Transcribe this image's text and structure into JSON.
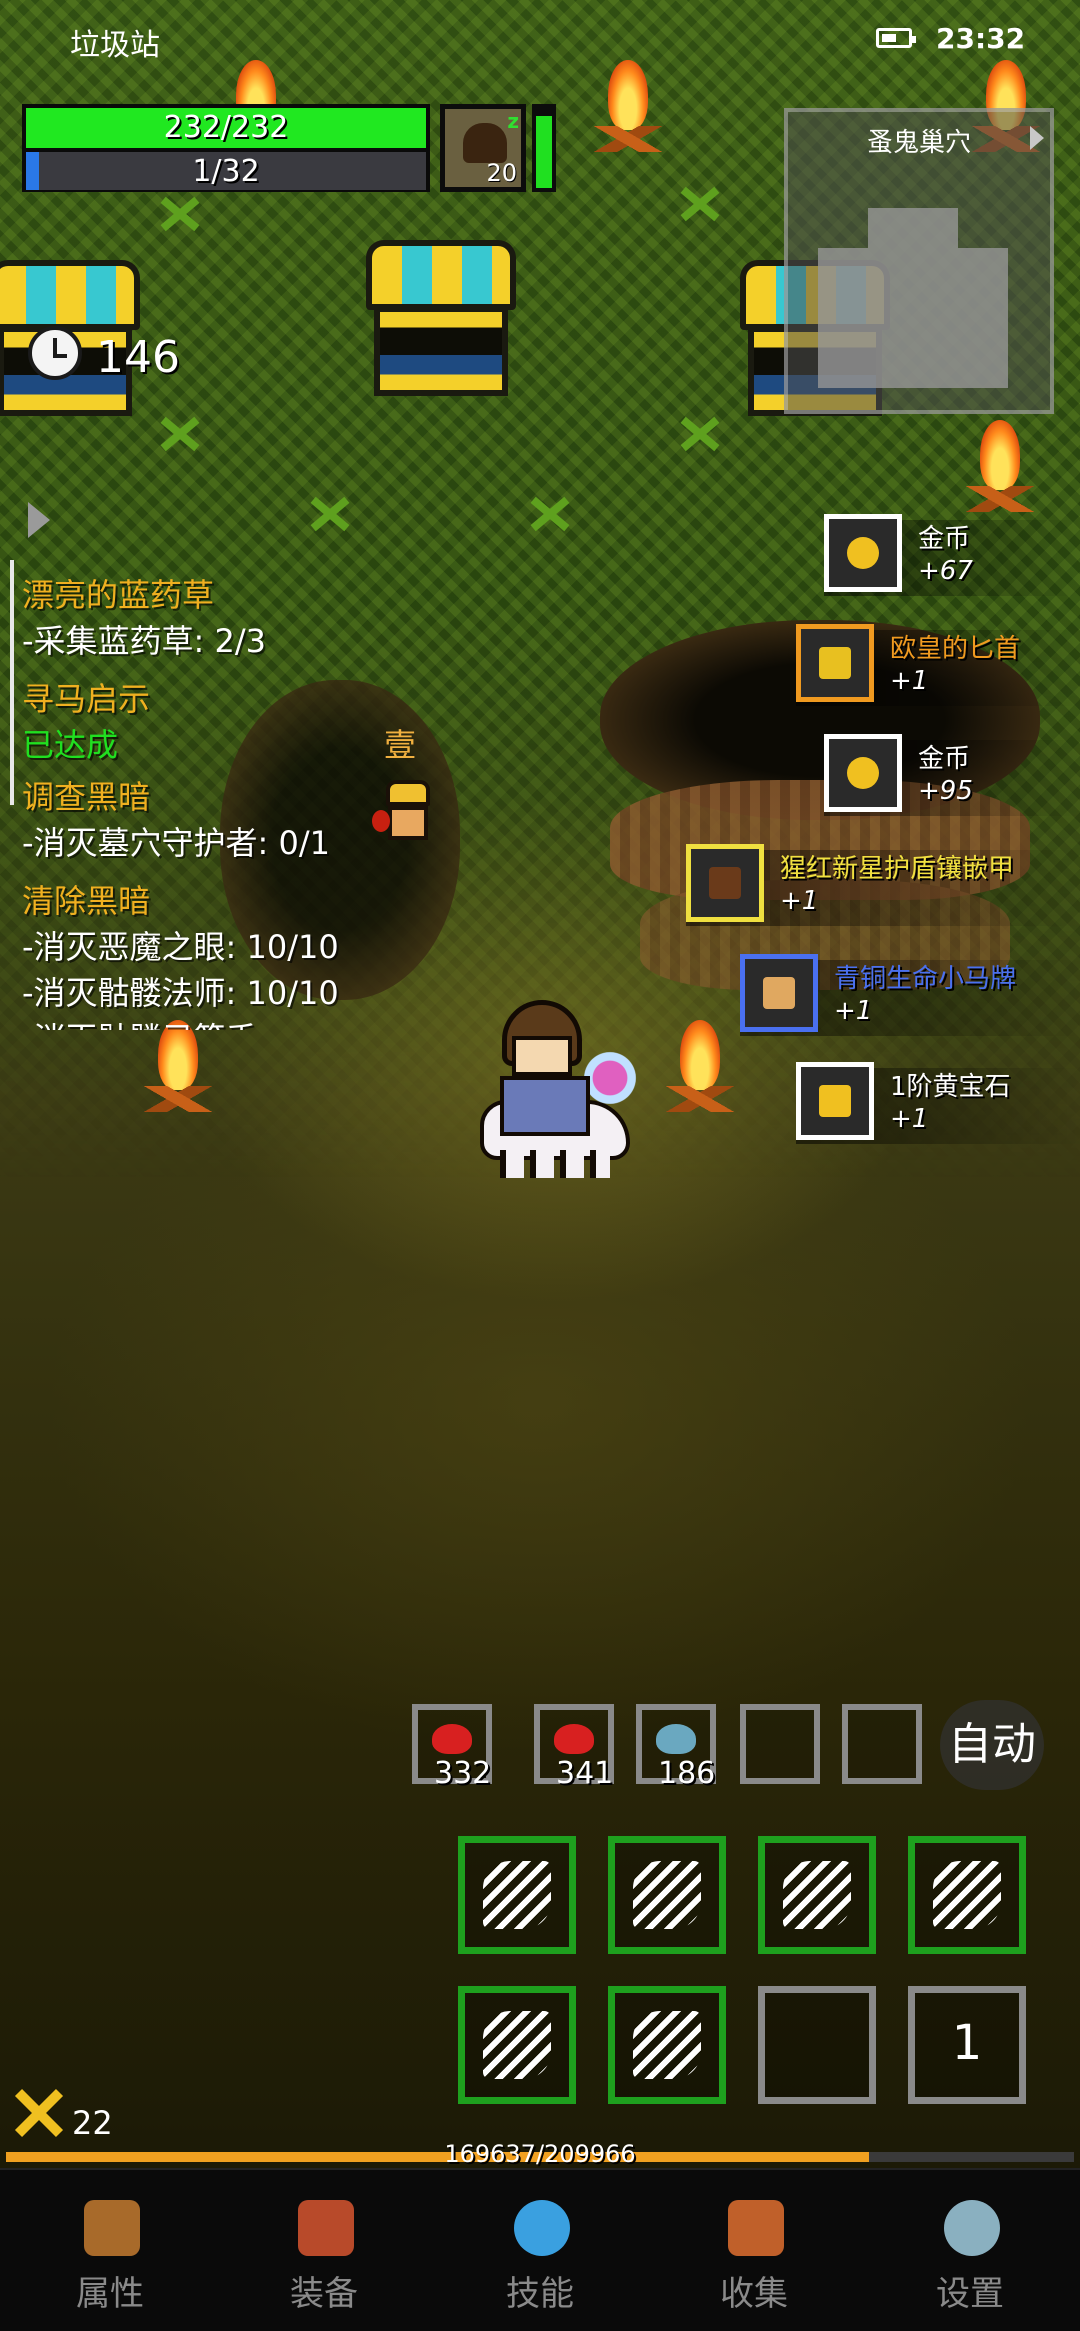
{
  "status_bar": {
    "app_name": "垃圾站",
    "time": "23:32"
  },
  "player": {
    "hp_text": "232/232",
    "hp_fraction": 1.0,
    "mp_text": "1/32",
    "mp_fraction": 0.03125
  },
  "pet": {
    "level": "20",
    "energy_fraction": 0.9
  },
  "minimap": {
    "title": "蚤鬼巢穴"
  },
  "timer": {
    "value": "146"
  },
  "npc": {
    "label": "壹"
  },
  "quests": [
    {
      "text": "漂亮的蓝药草",
      "kind": "title"
    },
    {
      "text": "-采集蓝药草: 2/3",
      "kind": "sub"
    },
    {
      "text": "寻马启示",
      "kind": "title"
    },
    {
      "text": "已达成",
      "kind": "done"
    },
    {
      "text": "调查黑暗",
      "kind": "title"
    },
    {
      "text": "-消灭墓穴守护者: 0/1",
      "kind": "sub"
    },
    {
      "text": "清除黑暗",
      "kind": "title"
    },
    {
      "text": "-消灭恶魔之眼: 10/10",
      "kind": "sub"
    },
    {
      "text": "-消灭骷髅法师: 10/10",
      "kind": "sub"
    },
    {
      "text": "-消灭骷髅弓箭手:",
      "kind": "sub"
    }
  ],
  "loot": [
    {
      "name": "金币",
      "amount": "+67",
      "color": "#ffffff",
      "frame": "#ffffff",
      "icon": "gold-coins-icon"
    },
    {
      "name": "欧皇的匕首",
      "amount": "+1",
      "color": "#f09a20",
      "frame": "#f09a20",
      "icon": "dagger-icon"
    },
    {
      "name": "金币",
      "amount": "+95",
      "color": "#ffffff",
      "frame": "#ffffff",
      "icon": "gold-coins-icon"
    },
    {
      "name": "猩红新星护盾镶嵌甲",
      "amount": "+1",
      "color": "#f0e040",
      "frame": "#f0e040",
      "icon": "armor-icon"
    },
    {
      "name": "青铜生命小马牌",
      "amount": "+1",
      "color": "#4a70f0",
      "frame": "#4a70f0",
      "icon": "amulet-icon"
    },
    {
      "name": "1阶黄宝石",
      "amount": "+1",
      "color": "#ffffff",
      "frame": "#ffffff",
      "icon": "yellow-gem-icon"
    }
  ],
  "quickbar": {
    "slots": [
      {
        "icon": "red-meat-icon",
        "count": "332",
        "color": "#d82020"
      },
      {
        "icon": "red-meat-icon",
        "count": "341",
        "color": "#d82020"
      },
      {
        "icon": "fish-icon",
        "count": "186",
        "color": "#6aa8c0"
      },
      {
        "icon": "",
        "count": "",
        "color": ""
      },
      {
        "icon": "",
        "count": "",
        "color": ""
      }
    ],
    "auto_label": "自动"
  },
  "skills": {
    "row1": [
      "demon-summon-icon",
      "wind-slash-icon",
      "fist-strike-icon",
      "arrow-burst-icon"
    ],
    "row2": [
      "wave-slash-icon",
      "crossed-blades-icon",
      "",
      ""
    ],
    "page_number": "1"
  },
  "kills": {
    "count": "22"
  },
  "experience": {
    "text": "169637/209966",
    "fraction": 0.808
  },
  "nav": [
    {
      "label": "属性",
      "icon": "helmet-icon"
    },
    {
      "label": "装备",
      "icon": "pouch-icon"
    },
    {
      "label": "技能",
      "icon": "blue-orb-icon"
    },
    {
      "label": "收集",
      "icon": "book-icon"
    },
    {
      "label": "设置",
      "icon": "gear-icon"
    }
  ],
  "colors": {
    "hp": "#20e820",
    "mp": "#2a78e8",
    "quest_title": "#f0b020",
    "quest_done": "#20e020",
    "skill_frame": "#1ea01e",
    "xp": "#f0a020"
  }
}
